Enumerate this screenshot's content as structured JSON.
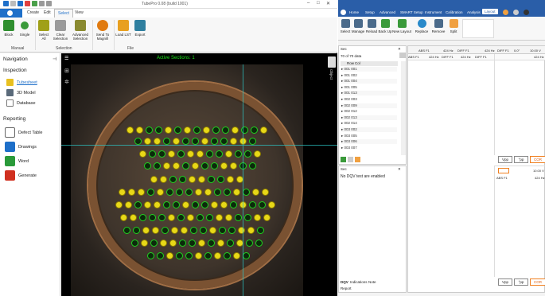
{
  "app1": {
    "title": "TubePro 0.08 (build 1001)",
    "tabs": [
      "Create",
      "Edit",
      "Select",
      "View"
    ],
    "selected_tab": "Select",
    "ribbon": {
      "buttons": [
        {
          "label": "Block",
          "color": "#2f8f2f"
        },
        {
          "label": "Single",
          "color": "#3a9a3a"
        },
        {
          "label": "Select All",
          "color": "#a0a018"
        },
        {
          "label": "Clear Selection",
          "color": "#9a9a9a"
        },
        {
          "label": "Advanced Selection",
          "color": "#8a8a30"
        },
        {
          "label": "Send To Magnifi",
          "color": "#e07a10"
        },
        {
          "label": "Load LST",
          "color": "#e8a020"
        },
        {
          "label": "Export",
          "color": "#2f7f9f"
        }
      ],
      "groups": [
        "Manual",
        "Selection",
        "File"
      ]
    },
    "navigation": {
      "title": "Navigation",
      "sections": [
        {
          "title": "Inspection",
          "items": [
            {
              "label": "Tubesheet",
              "icon": "tubesheet-icon",
              "active": true
            },
            {
              "label": "3D Model",
              "icon": "cube-icon",
              "active": false
            },
            {
              "label": "Database",
              "icon": "database-icon",
              "active": false
            }
          ]
        },
        {
          "title": "Reporting",
          "items": [
            {
              "label": "Defect Table",
              "icon": "table-icon"
            },
            {
              "label": "Drawings",
              "icon": "pen-icon"
            },
            {
              "label": "Word",
              "icon": "word-icon"
            },
            {
              "label": "Generate",
              "icon": "pdf-icon"
            }
          ]
        }
      ]
    },
    "viewer": {
      "active_sections_text": "Active Sections: 1",
      "side_tab": "Object"
    }
  },
  "app2": {
    "tabs": [
      "Home",
      "Setup",
      "Advanced",
      "SMART Setup",
      "Instrument",
      "Calibration",
      "Analysis",
      "Layout"
    ],
    "selected_tab": "Layout",
    "ribbon_buttons": [
      "Select",
      "Manage",
      "Reload",
      "Back Up",
      "New Layout",
      "Replace",
      "Remove",
      "Split"
    ],
    "list_panel": {
      "title": "Sec",
      "count_text": "70 of 70 data",
      "columns": [
        "Row",
        "Col"
      ],
      "rows": [
        [
          "001",
          "001"
        ],
        [
          "001",
          "002"
        ],
        [
          "001",
          "004"
        ],
        [
          "001",
          "005"
        ],
        [
          "001",
          "013"
        ],
        [
          "002",
          "003"
        ],
        [
          "002",
          "009"
        ],
        [
          "002",
          "012"
        ],
        [
          "002",
          "013"
        ],
        [
          "002",
          "014"
        ],
        [
          "003",
          "002"
        ],
        [
          "003",
          "005"
        ],
        [
          "003",
          "006"
        ],
        [
          "003",
          "007"
        ]
      ]
    },
    "info_panel": {
      "title": "Sec",
      "text": "No DQV test are enabled",
      "tabs": [
        "DQV",
        "Indications",
        "Note"
      ],
      "footer": "Report"
    },
    "strip": {
      "header": [
        "ABS F1",
        "424 Hz",
        "DIFF F1",
        "424 Hz",
        "DIFF F1",
        "0.0°",
        "10.00 V",
        "424 Hz"
      ],
      "channel_labels": [
        "ABS F1",
        "424 Hz"
      ],
      "buttons": [
        "Vpp",
        "°pp",
        "COR"
      ]
    }
  }
}
